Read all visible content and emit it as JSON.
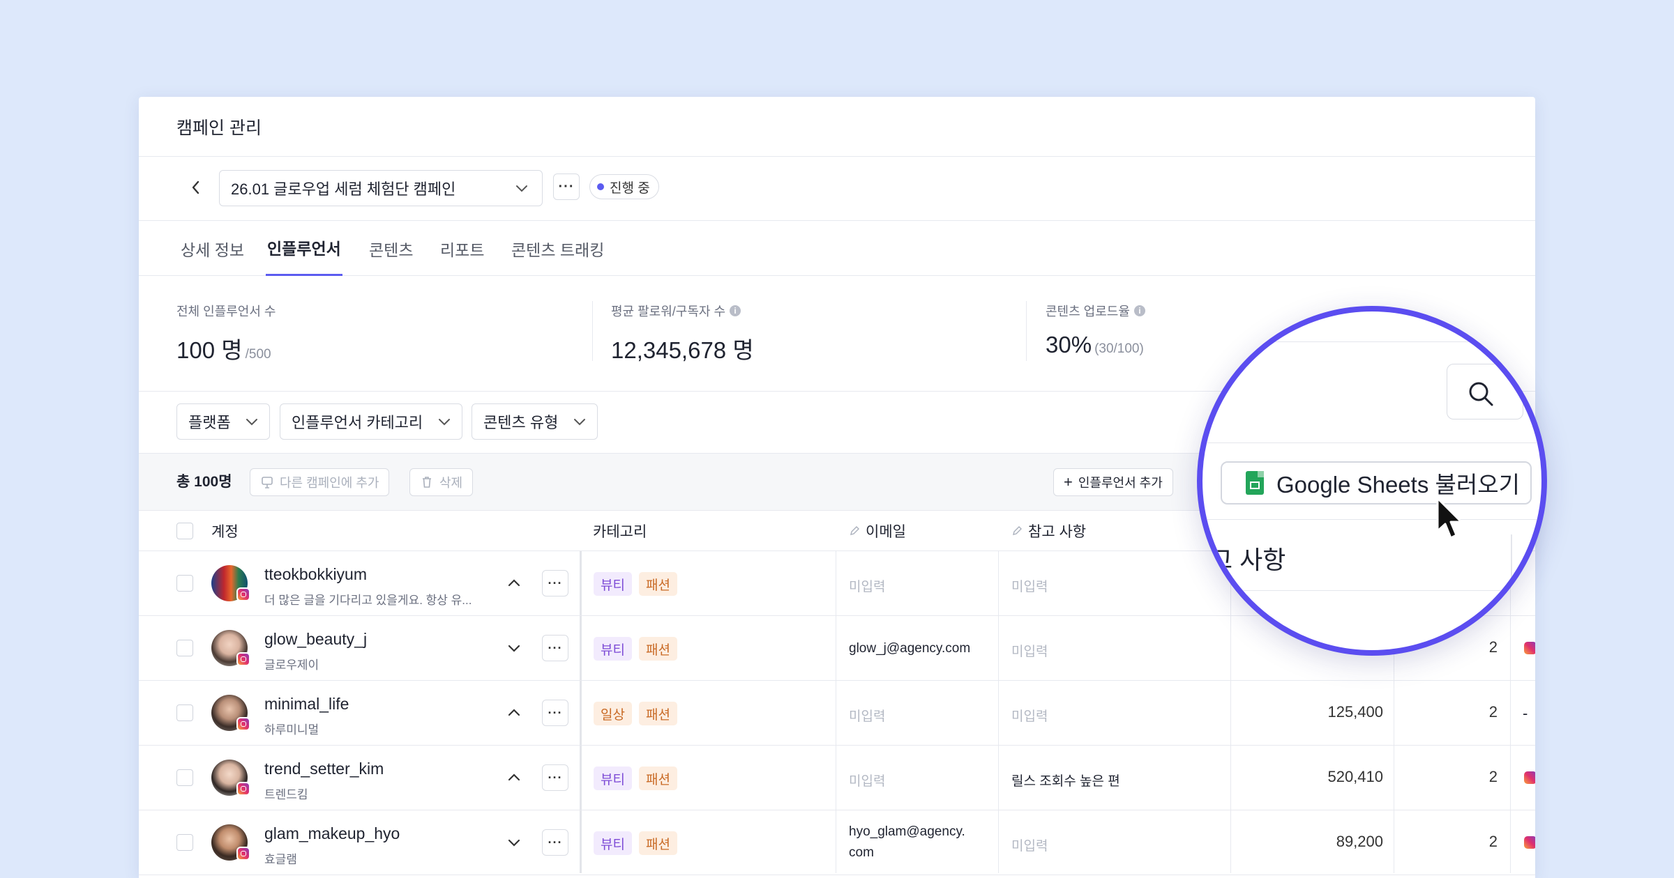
{
  "header": {
    "title": "캠페인 관리"
  },
  "campaign": {
    "name": "26.01 글로우업 세럼 체험단 캠페인",
    "status": "진행 중",
    "status_color": "#5b5bf0"
  },
  "tabs": [
    {
      "label": "상세 정보"
    },
    {
      "label": "인플루언서"
    },
    {
      "label": "콘텐츠"
    },
    {
      "label": "리포트"
    },
    {
      "label": "콘텐츠 트래킹"
    }
  ],
  "active_tab": "인플루언서",
  "stats": [
    {
      "label": "전체 인플루언서 수",
      "value": "100 명",
      "sub": "/500",
      "info": false
    },
    {
      "label": "평균 팔로워/구독자 수",
      "value": "12,345,678 명",
      "sub": "",
      "info": true
    },
    {
      "label": "콘텐츠 업로드율",
      "value": "30%",
      "sub": "(30/100)",
      "info": true
    }
  ],
  "filters": [
    {
      "label": "플랫폼"
    },
    {
      "label": "인플루언서 카테고리"
    },
    {
      "label": "콘텐츠 유형"
    }
  ],
  "toolbar": {
    "total": "총 100명",
    "add_to_other": "다른 캠페인에 추가",
    "delete": "삭제",
    "add_influencer": "인플루언서 추가"
  },
  "columns": [
    {
      "label": "계정"
    },
    {
      "label": "카테고리"
    },
    {
      "label": "이메일"
    },
    {
      "label": "참고 사항"
    }
  ],
  "rows": [
    {
      "account": "tteokbokkiyum",
      "sub": "더 많은 글을 기다리고 있을게요. 항상 유...",
      "expanded": true,
      "tags": [
        "뷰티",
        "패션"
      ],
      "email": "미입력",
      "email_empty": true,
      "note": "미입력",
      "note_empty": true,
      "followers": "",
      "count": ""
    },
    {
      "account": "glow_beauty_j",
      "sub": "글로우제이",
      "expanded": false,
      "tags": [
        "뷰티",
        "패션"
      ],
      "email": "glow_j@agency.com",
      "email_empty": false,
      "note": "미입력",
      "note_empty": true,
      "followers": "",
      "count": "2"
    },
    {
      "account": "minimal_life",
      "sub": "하루미니멀",
      "expanded": true,
      "tags": [
        "일상",
        "패션"
      ],
      "email": "미입력",
      "email_empty": true,
      "note": "미입력",
      "note_empty": true,
      "followers": "125,400",
      "count": "2",
      "extra": "-"
    },
    {
      "account": "trend_setter_kim",
      "sub": "트렌드킴",
      "expanded": true,
      "tags": [
        "뷰티",
        "패션"
      ],
      "email": "미입력",
      "email_empty": true,
      "note": "릴스 조회수 높은 편",
      "note_empty": false,
      "followers": "520,410",
      "count": "2"
    },
    {
      "account": "glam_makeup_hyo",
      "sub": "효글램",
      "expanded": false,
      "tags": [
        "뷰티",
        "패션"
      ],
      "email_line1": "hyo_glam@agency.",
      "email_line2": "com",
      "email_empty": false,
      "note": "미입력",
      "note_empty": true,
      "followers": "89,200",
      "count": "2"
    }
  ],
  "magnifier": {
    "sheets_button": "Google Sheets 불러오기",
    "column_text": "고 사항"
  },
  "colors": {
    "accent": "#5b4df0",
    "background": "#dde8fb",
    "tag_purple": "#f2ebfd",
    "tag_orange": "#fdeee1"
  }
}
